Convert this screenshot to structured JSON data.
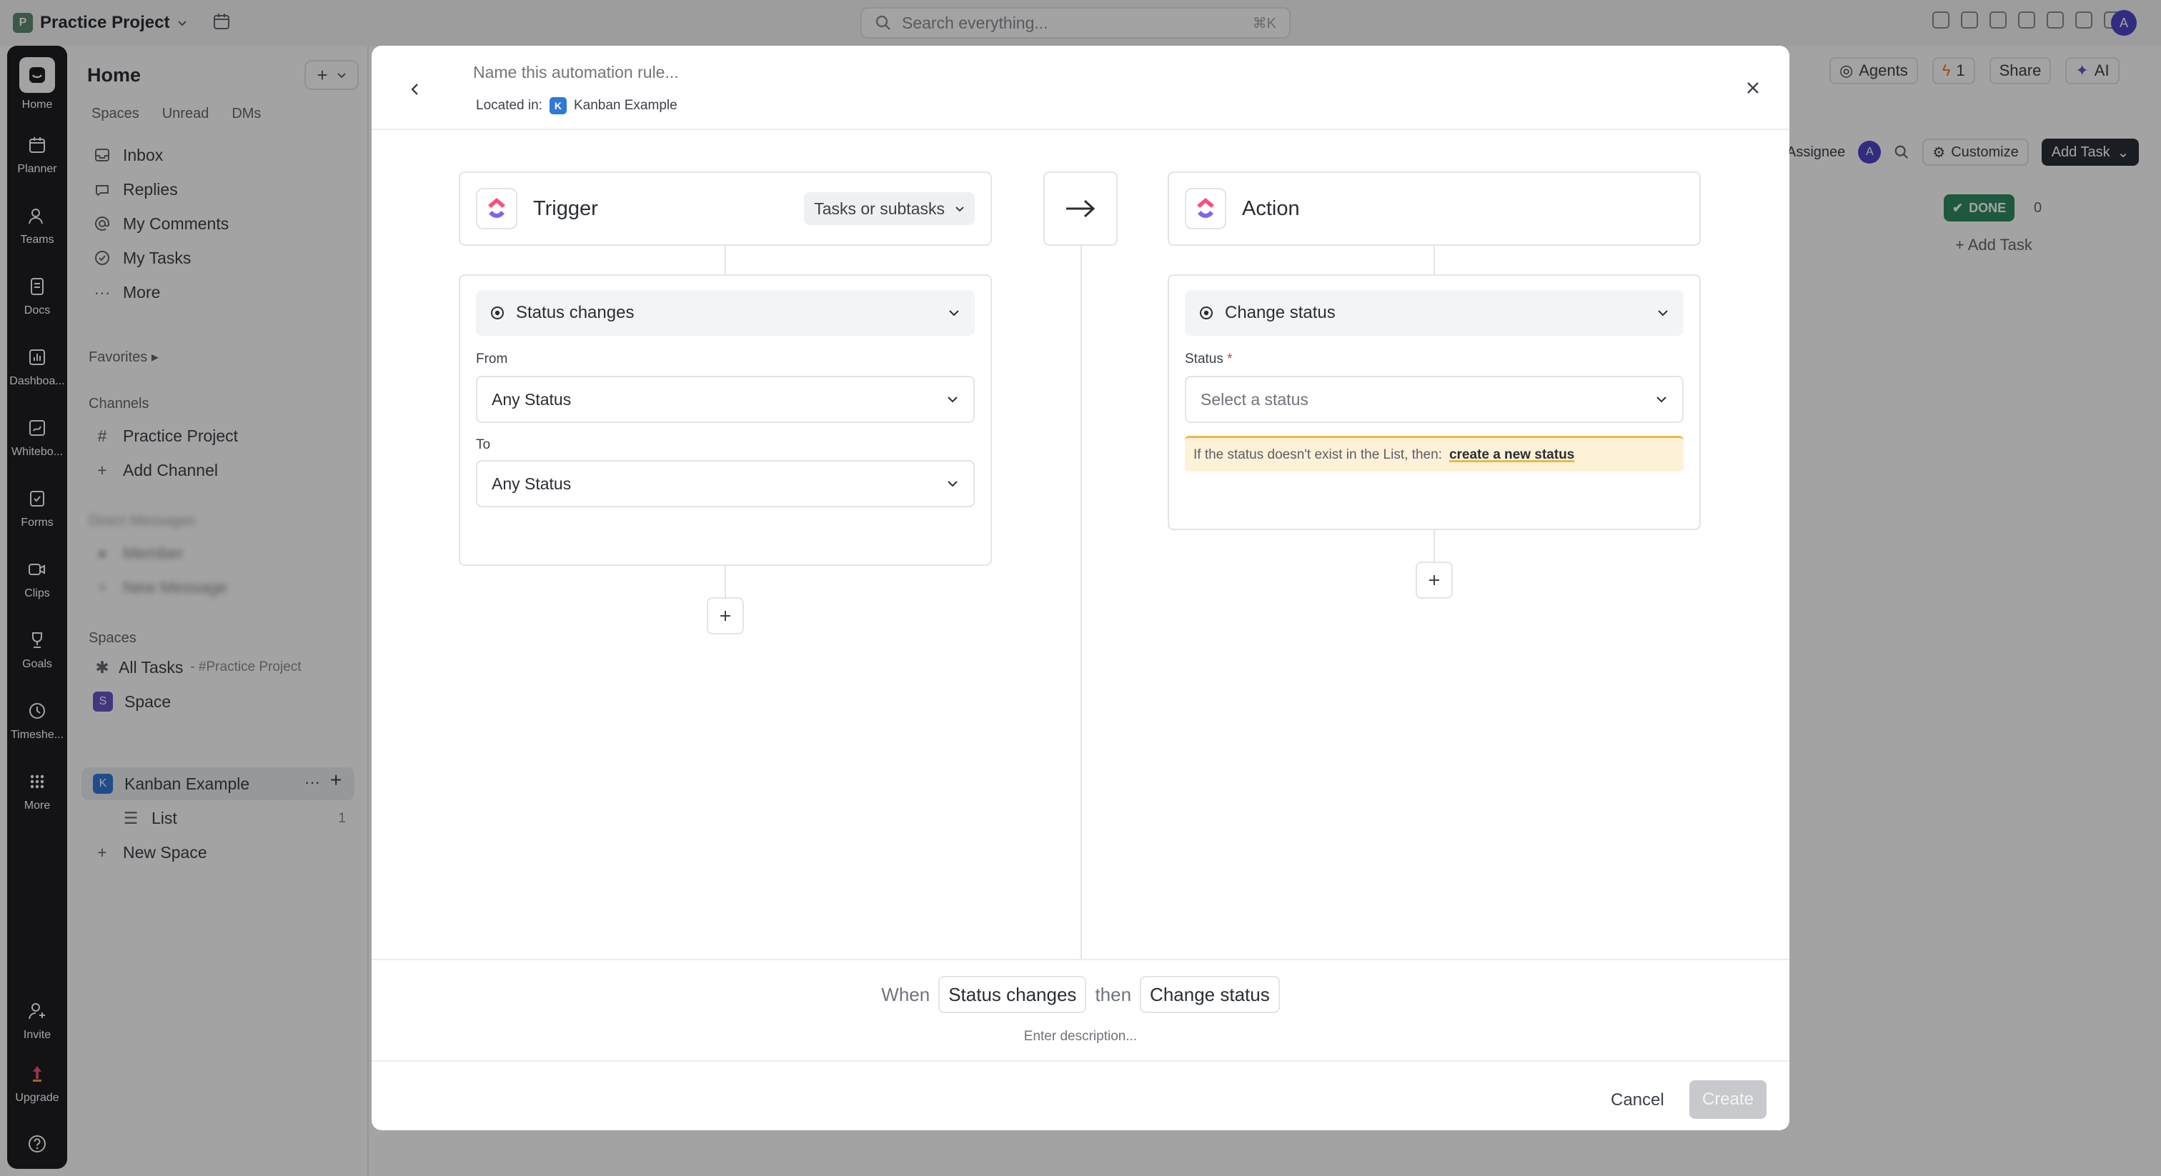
{
  "topbar": {
    "workspace_badge": "P",
    "workspace_name": "Practice Project",
    "search_placeholder": "Search everything...",
    "search_shortcut": "⌘K",
    "avatar_letter": "A"
  },
  "rail": [
    {
      "label": "Home",
      "icon": "home-icon"
    },
    {
      "label": "Planner",
      "icon": "planner-icon"
    },
    {
      "label": "Teams",
      "icon": "teams-icon"
    },
    {
      "label": "Docs",
      "icon": "docs-icon"
    },
    {
      "label": "Dashboa...",
      "icon": "dashboards-icon"
    },
    {
      "label": "Whitebo...",
      "icon": "whiteboards-icon"
    },
    {
      "label": "Forms",
      "icon": "forms-icon"
    },
    {
      "label": "Clips",
      "icon": "clips-icon"
    },
    {
      "label": "Goals",
      "icon": "goals-icon"
    },
    {
      "label": "Timeshe...",
      "icon": "timesheets-icon"
    },
    {
      "label": "More",
      "icon": "more-grid-icon"
    },
    {
      "label": "Invite",
      "icon": "invite-icon"
    },
    {
      "label": "Upgrade",
      "icon": "upgrade-icon"
    }
  ],
  "sidebar": {
    "title": "Home",
    "tabs": [
      "Spaces",
      "Unread",
      "DMs"
    ],
    "nav": [
      "Inbox",
      "Replies",
      "My Comments",
      "My Tasks",
      "More"
    ],
    "favorites_label": "Favorites",
    "channels_label": "Channels",
    "channel_name": "Practice Project",
    "add_channel": "Add Channel",
    "dm_label": "Direct Messages",
    "dm_user": "Member",
    "new_message": "New Message",
    "spaces_label": "Spaces",
    "all_tasks": "All Tasks",
    "all_tasks_scope": "- #Practice Project",
    "space_badge": "S",
    "space_name": "Space",
    "kanban_badge": "K",
    "kanban_name": "Kanban Example",
    "list_name": "List",
    "list_count": "1",
    "new_space": "New Space"
  },
  "board": {
    "agents": "Agents",
    "bolt_count": "1",
    "share": "Share",
    "ai": "AI",
    "assignee": "Assignee",
    "assignee_avatar": "A",
    "customize": "Customize",
    "add_task": "Add Task",
    "done_label": "DONE",
    "done_count": "0",
    "add_task_column": "Add Task"
  },
  "modal": {
    "name_placeholder": "Name this automation rule...",
    "located_in_label": "Located in:",
    "location_badge": "K",
    "location_name": "Kanban Example",
    "trigger": {
      "title": "Trigger",
      "scope": "Tasks or subtasks",
      "event": "Status changes",
      "from_label": "From",
      "from_value": "Any Status",
      "to_label": "To",
      "to_value": "Any Status"
    },
    "action": {
      "title": "Action",
      "event": "Change status",
      "status_label": "Status",
      "required_mark": "*",
      "status_placeholder": "Select a status",
      "warning_text": "If the status doesn't exist in the List, then:",
      "warning_link": "create a new status"
    },
    "summary": {
      "when": "When",
      "trigger_chip": "Status changes",
      "then": "then",
      "action_chip": "Change status",
      "description_placeholder": "Enter description..."
    },
    "cancel": "Cancel",
    "create": "Create"
  }
}
